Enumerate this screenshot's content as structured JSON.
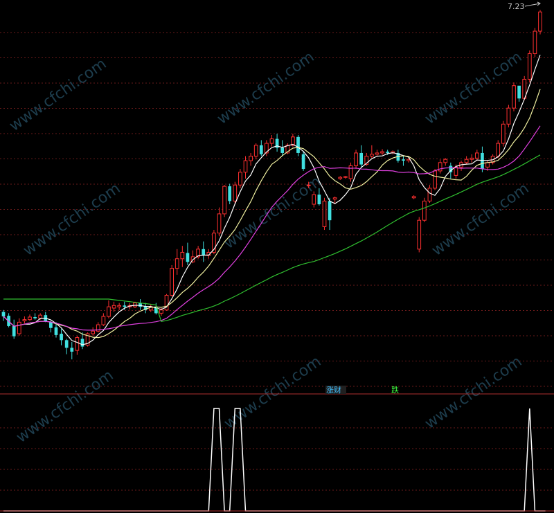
{
  "chart_data": {
    "type": "candlestick",
    "price_label": "7.23",
    "indicator_labels": [
      "涨财",
      "跌"
    ],
    "ma_colors": {
      "ma_short": "#ffffff",
      "ma_mid": "#f0f0a0",
      "ma_long": "#e040e0",
      "ma_longest": "#30c030"
    },
    "candle_colors": {
      "up": "#ff3030",
      "down": "#40e0e0"
    },
    "watermark": "www.cfchi.com",
    "price_range": [
      1.5,
      7.3
    ],
    "candles": [
      [
        2.52,
        2.55,
        2.45,
        2.38
      ],
      [
        2.46,
        2.5,
        2.3,
        2.28
      ],
      [
        2.3,
        2.4,
        2.14,
        2.1
      ],
      [
        2.18,
        2.42,
        2.36,
        2.15
      ],
      [
        2.38,
        2.45,
        2.4,
        2.34
      ],
      [
        2.4,
        2.48,
        2.44,
        2.38
      ],
      [
        2.44,
        2.5,
        2.42,
        2.4
      ],
      [
        2.42,
        2.5,
        2.47,
        2.4
      ],
      [
        2.47,
        2.52,
        2.38,
        2.36
      ],
      [
        2.36,
        2.38,
        2.27,
        2.2
      ],
      [
        2.28,
        2.36,
        2.16,
        2.12
      ],
      [
        2.18,
        2.26,
        2.08,
        2.0
      ],
      [
        2.08,
        2.1,
        1.96,
        1.86
      ],
      [
        1.96,
        2.05,
        1.9,
        1.78
      ],
      [
        1.92,
        2.15,
        2.12,
        1.85
      ],
      [
        2.1,
        2.2,
        1.98,
        1.94
      ],
      [
        2.0,
        2.2,
        2.18,
        1.98
      ],
      [
        2.18,
        2.28,
        2.22,
        2.15
      ],
      [
        2.22,
        2.36,
        2.32,
        2.2
      ],
      [
        2.32,
        2.5,
        2.45,
        2.3
      ],
      [
        2.45,
        2.7,
        2.6,
        2.42
      ],
      [
        2.58,
        2.68,
        2.62,
        2.52
      ],
      [
        2.6,
        2.66,
        2.62,
        2.55
      ],
      [
        2.62,
        2.68,
        2.6,
        2.55
      ],
      [
        2.6,
        2.66,
        2.62,
        2.56
      ],
      [
        2.6,
        2.68,
        2.66,
        2.58
      ],
      [
        2.66,
        2.72,
        2.6,
        2.55
      ],
      [
        2.6,
        2.66,
        2.55,
        2.5
      ],
      [
        2.55,
        2.64,
        2.6,
        2.52
      ],
      [
        2.6,
        2.66,
        2.5,
        2.48
      ],
      [
        2.5,
        2.58,
        2.55,
        2.46
      ],
      [
        2.55,
        2.8,
        2.78,
        2.54
      ],
      [
        2.78,
        3.25,
        3.2,
        2.76
      ],
      [
        3.2,
        3.5,
        3.35,
        3.1
      ],
      [
        3.35,
        3.55,
        3.45,
        3.22
      ],
      [
        3.44,
        3.6,
        3.3,
        3.25
      ],
      [
        3.3,
        3.48,
        3.38,
        3.28
      ],
      [
        3.38,
        3.55,
        3.5,
        3.35
      ],
      [
        3.5,
        3.62,
        3.4,
        3.3
      ],
      [
        3.4,
        3.5,
        3.45,
        3.35
      ],
      [
        3.45,
        3.8,
        3.75,
        3.42
      ],
      [
        3.75,
        4.15,
        4.05,
        3.7
      ],
      [
        4.05,
        4.5,
        4.48,
        4.0
      ],
      [
        4.48,
        4.52,
        4.25,
        4.2
      ],
      [
        4.25,
        4.55,
        4.5,
        4.2
      ],
      [
        4.5,
        4.75,
        4.7,
        4.45
      ],
      [
        4.7,
        4.95,
        4.88,
        4.6
      ],
      [
        4.88,
        5.0,
        4.95,
        4.8
      ],
      [
        4.95,
        5.15,
        5.12,
        4.9
      ],
      [
        5.12,
        5.2,
        4.98,
        4.95
      ],
      [
        5.0,
        5.2,
        5.15,
        4.95
      ],
      [
        5.15,
        5.28,
        5.22,
        5.1
      ],
      [
        5.22,
        5.3,
        5.08,
        5.02
      ],
      [
        5.08,
        5.2,
        5.0,
        4.95
      ],
      [
        5.0,
        5.15,
        5.12,
        4.98
      ],
      [
        5.12,
        5.3,
        5.25,
        5.1
      ],
      [
        5.25,
        5.28,
        5.0,
        4.95
      ],
      [
        4.98,
        5.02,
        4.75,
        4.72
      ],
      [
        4.5,
        4.55,
        4.5,
        4.45
      ],
      [
        4.2,
        4.4,
        4.35,
        4.15
      ],
      [
        4.35,
        4.45,
        4.2,
        4.18
      ],
      [
        3.85,
        4.3,
        4.25,
        3.8
      ],
      [
        4.25,
        4.3,
        3.95,
        3.8
      ],
      [
        4.28,
        4.32,
        4.3,
        4.2
      ],
      [
        4.6,
        4.64,
        4.62,
        4.58
      ],
      [
        4.62,
        4.64,
        4.63,
        4.6
      ],
      [
        4.6,
        4.85,
        4.8,
        4.55
      ],
      [
        4.8,
        5.05,
        5.0,
        4.75
      ],
      [
        5.0,
        5.12,
        4.82,
        4.78
      ],
      [
        4.82,
        5.0,
        4.95,
        4.8
      ],
      [
        4.95,
        5.12,
        4.98,
        4.92
      ],
      [
        4.98,
        5.05,
        5.0,
        4.95
      ],
      [
        5.0,
        5.06,
        5.02,
        4.97
      ],
      [
        5.02,
        5.05,
        5.0,
        4.97
      ],
      [
        5.0,
        5.04,
        5.02,
        4.98
      ],
      [
        5.0,
        5.05,
        4.88,
        4.85
      ],
      [
        4.9,
        4.95,
        4.88,
        4.8
      ],
      [
        4.88,
        4.92,
        4.9,
        4.85
      ],
      [
        4.3,
        4.34,
        4.32,
        4.28
      ],
      [
        3.5,
        4.0,
        3.95,
        3.45
      ],
      [
        3.95,
        4.3,
        4.25,
        3.92
      ],
      [
        4.25,
        4.5,
        4.45,
        4.22
      ],
      [
        4.45,
        4.75,
        4.72,
        4.42
      ],
      [
        4.72,
        4.9,
        4.85,
        4.68
      ],
      [
        4.85,
        4.92,
        4.9,
        4.8
      ],
      [
        4.8,
        4.85,
        4.7,
        4.6
      ],
      [
        4.65,
        4.82,
        4.78,
        4.6
      ],
      [
        4.78,
        4.88,
        4.85,
        4.72
      ],
      [
        4.85,
        4.95,
        4.9,
        4.82
      ],
      [
        4.9,
        4.98,
        4.92,
        4.85
      ],
      [
        4.92,
        5.05,
        5.0,
        4.88
      ],
      [
        5.0,
        5.1,
        4.75,
        4.7
      ],
      [
        4.78,
        4.88,
        4.85,
        4.72
      ],
      [
        4.85,
        4.98,
        4.95,
        4.82
      ],
      [
        4.95,
        5.2,
        5.15,
        4.92
      ],
      [
        5.15,
        5.5,
        5.45,
        5.1
      ],
      [
        5.45,
        5.75,
        5.7,
        5.4
      ],
      [
        5.7,
        6.1,
        6.05,
        5.65
      ],
      [
        6.05,
        6.0,
        5.85,
        5.8
      ],
      [
        5.85,
        6.2,
        6.15,
        5.82
      ],
      [
        6.15,
        6.6,
        6.55,
        6.1
      ],
      [
        6.55,
        6.95,
        6.9,
        6.5
      ],
      [
        6.9,
        7.23,
        7.2,
        6.85
      ]
    ],
    "signal": [
      0,
      0,
      0,
      0,
      0,
      0,
      0,
      0,
      0,
      0,
      0,
      0,
      0,
      0,
      0,
      0,
      0,
      0,
      0,
      0,
      0,
      0,
      0,
      0,
      0,
      0,
      0,
      0,
      0,
      0,
      0,
      0,
      0,
      0,
      0,
      0,
      0,
      0,
      0,
      0,
      1,
      1,
      0,
      0,
      1,
      1,
      0,
      0,
      0,
      0,
      0,
      0,
      0,
      0,
      0,
      0,
      0,
      0,
      0,
      0,
      0,
      0,
      0,
      0,
      0,
      0,
      0,
      0,
      0,
      0,
      0,
      0,
      0,
      0,
      0,
      0,
      0,
      0,
      0,
      0,
      0,
      0,
      0,
      0,
      0,
      0,
      0,
      0,
      0,
      0,
      0,
      0,
      0,
      0,
      0,
      0,
      0,
      0,
      0,
      0,
      1,
      0,
      0,
      0
    ]
  }
}
